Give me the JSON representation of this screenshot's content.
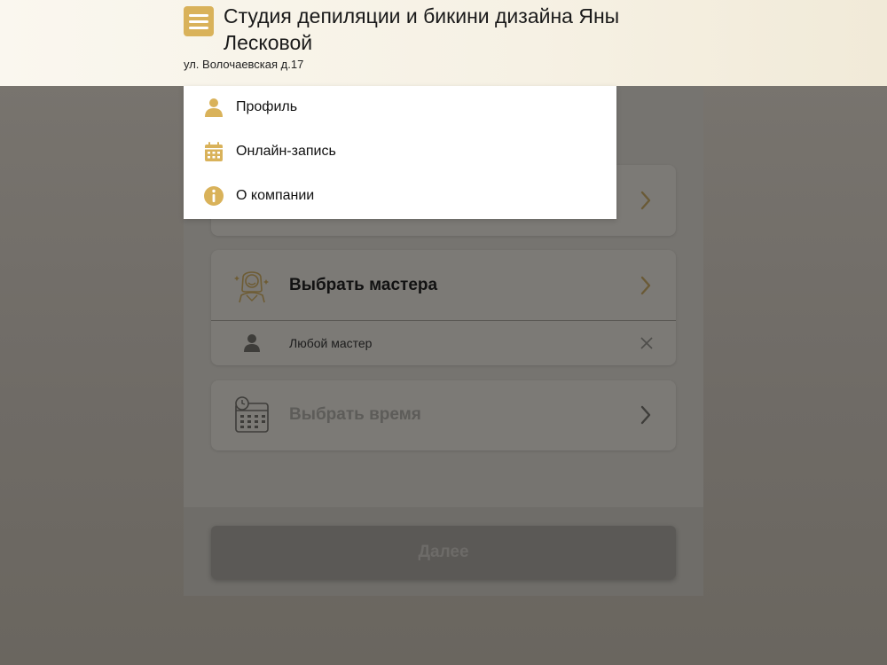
{
  "header": {
    "title": "Студия депиляции и бикини дизайна Яны Лесковой",
    "address": "ул. Волочаевская д.17",
    "menu_icon": "hamburger-menu-icon"
  },
  "menu": {
    "items": [
      {
        "label": "Профиль",
        "icon": "user-icon"
      },
      {
        "label": "Онлайн-запись",
        "icon": "calendar-icon"
      },
      {
        "label": "О компании",
        "icon": "info-icon"
      }
    ]
  },
  "booking": {
    "master_card": {
      "label": "Выбрать мастера",
      "selected_label": "Любой мастер",
      "icon": "master-avatar-icon"
    },
    "time_card": {
      "label": "Выбрать время",
      "icon": "calendar-clock-icon"
    },
    "next_label": "Далее"
  },
  "colors": {
    "accent": "#d9b25a",
    "overlay": "#767470",
    "dropdown_bg": "#ffffff"
  }
}
